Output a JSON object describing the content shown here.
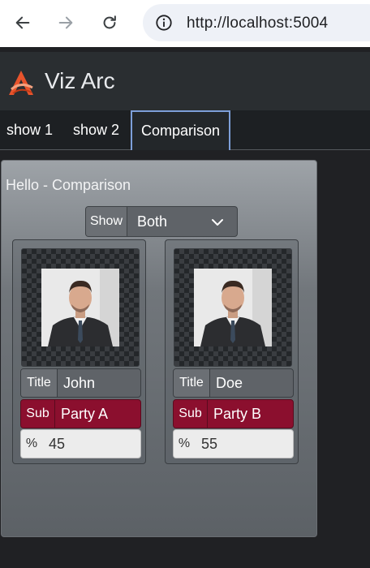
{
  "browser": {
    "url": "http://localhost:5004",
    "back_icon": "arrow-left-icon",
    "forward_icon": "arrow-right-icon",
    "reload_icon": "reload-icon",
    "info_icon": "info-icon"
  },
  "app": {
    "title": "Viz Arc",
    "logo_icon": "viz-arc-logo-icon"
  },
  "tabs": [
    {
      "label": "show 1",
      "active": false
    },
    {
      "label": "show 2",
      "active": false
    },
    {
      "label": "Comparison",
      "active": true
    }
  ],
  "panel": {
    "title": "Hello - Comparison",
    "show": {
      "label": "Show",
      "value": "Both"
    }
  },
  "cards": [
    {
      "title_label": "Title",
      "title_value": "John",
      "sub_label": "Sub",
      "sub_value": "Party A",
      "pct_label": "%",
      "pct_value": "45"
    },
    {
      "title_label": "Title",
      "title_value": "Doe",
      "sub_label": "Sub",
      "sub_value": "Party B",
      "pct_label": "%",
      "pct_value": "55"
    }
  ],
  "colors": {
    "sub_background": "#8b0f2e",
    "active_tab_border": "#7d9fd9"
  }
}
